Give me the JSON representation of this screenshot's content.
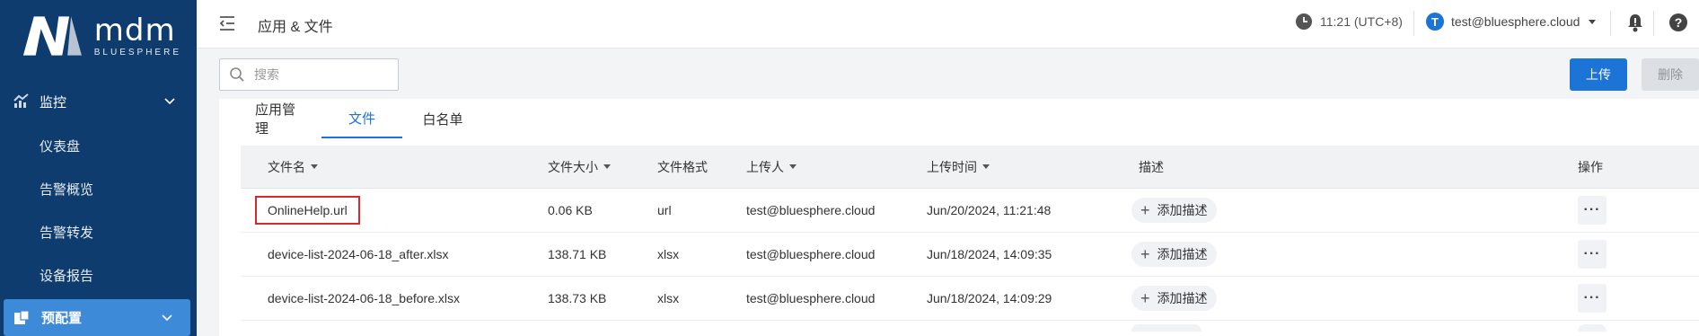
{
  "brand": {
    "name": "mdm",
    "sub": "BLUESPHERE"
  },
  "sidebar": {
    "group_monitor": "监控",
    "items": [
      "仪表盘",
      "告警概览",
      "告警转发",
      "设备报告"
    ],
    "group_active": "预配置"
  },
  "header": {
    "title": "应用 & 文件",
    "time": "11:21 (UTC+8)",
    "user": "test@bluesphere.cloud",
    "avatar_letter": "T",
    "help": "?"
  },
  "toolbar": {
    "search_placeholder": "搜索",
    "upload_label": "上传",
    "delete_label": "删除"
  },
  "tabs": [
    "应用管理",
    "文件",
    "白名单"
  ],
  "active_tab": "文件",
  "table": {
    "columns": {
      "name": "文件名",
      "size": "文件大小",
      "format": "文件格式",
      "uploader": "上传人",
      "time": "上传时间",
      "desc": "描述",
      "action": "操作"
    },
    "rows": [
      {
        "name": "OnlineHelp.url",
        "size": "0.06 KB",
        "format": "url",
        "uploader": "test@bluesphere.cloud",
        "time": "Jun/20/2024, 11:21:48",
        "desc": "添加描述",
        "more": "···"
      },
      {
        "name": "device-list-2024-06-18_after.xlsx",
        "size": "138.71 KB",
        "format": "xlsx",
        "uploader": "test@bluesphere.cloud",
        "time": "Jun/18/2024, 14:09:35",
        "desc": "添加描述",
        "more": "···"
      },
      {
        "name": "device-list-2024-06-18_before.xlsx",
        "size": "138.73 KB",
        "format": "xlsx",
        "uploader": "test@bluesphere.cloud",
        "time": "Jun/18/2024, 14:09:29",
        "desc": "添加描述",
        "more": "···"
      }
    ]
  },
  "colors": {
    "sidebar_bg": "#0f3c6e",
    "active_nav": "#3d8ad8",
    "accent": "#1b74d6",
    "highlight_border": "#d42a2a"
  }
}
